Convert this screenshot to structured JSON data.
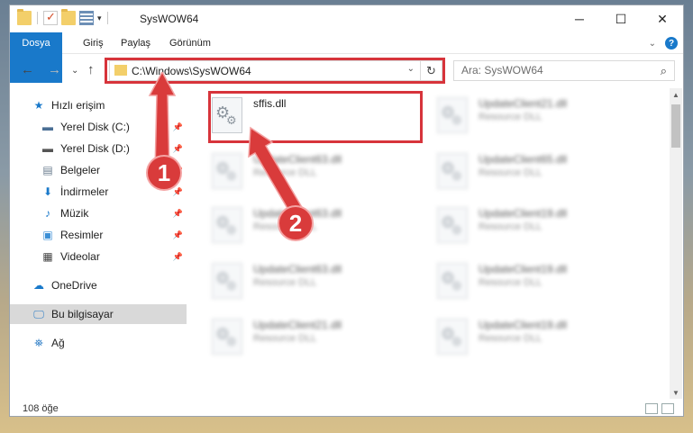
{
  "window": {
    "title": "SysWOW64",
    "controls": {
      "minimize": "─",
      "maximize": "☐",
      "close": "✕"
    },
    "qat_dropdown": "▾"
  },
  "ribbon": {
    "tabs": [
      "Dosya",
      "Giriş",
      "Paylaş",
      "Görünüm"
    ],
    "expand": "⌄",
    "help": "?"
  },
  "nav": {
    "back": "←",
    "forward": "→",
    "recent": "⌄",
    "up": "↑"
  },
  "address": {
    "path": "C:\\Windows\\SysWOW64",
    "dropdown": "⌄",
    "refresh": "↻"
  },
  "search": {
    "placeholder": "Ara: SysWOW64",
    "icon": "⌕"
  },
  "sidebar": {
    "items": [
      {
        "label": "Hızlı erişim",
        "icon": "star-icon",
        "glyph": "★",
        "color": "#1979ca",
        "pinned": false
      },
      {
        "label": "Yerel Disk (C:)",
        "icon": "drive-icon",
        "glyph": "▬",
        "color": "#4a6e94",
        "pinned": true
      },
      {
        "label": "Yerel Disk (D:)",
        "icon": "drive-icon",
        "glyph": "▬",
        "color": "#555",
        "pinned": true
      },
      {
        "label": "Belgeler",
        "icon": "documents-icon",
        "glyph": "▤",
        "color": "#6b7d8f",
        "pinned": true
      },
      {
        "label": "İndirmeler",
        "icon": "download-icon",
        "glyph": "⬇",
        "color": "#1979ca",
        "pinned": true
      },
      {
        "label": "Müzik",
        "icon": "music-icon",
        "glyph": "♪",
        "color": "#1979ca",
        "pinned": true
      },
      {
        "label": "Resimler",
        "icon": "pictures-icon",
        "glyph": "▣",
        "color": "#3b8fd6",
        "pinned": true
      },
      {
        "label": "Videolar",
        "icon": "video-icon",
        "glyph": "▦",
        "color": "#444",
        "pinned": true
      },
      {
        "label": "OneDrive",
        "icon": "cloud-icon",
        "glyph": "☁",
        "color": "#1979ca",
        "pinned": false
      },
      {
        "label": "Bu bilgisayar",
        "icon": "computer-icon",
        "glyph": "🖵",
        "color": "#2d7dc6",
        "pinned": false
      },
      {
        "label": "Ağ",
        "icon": "network-icon",
        "glyph": "⛯",
        "color": "#2d7dc6",
        "pinned": false
      }
    ],
    "pin_glyph": "📌"
  },
  "files": [
    {
      "name": "sffis.dll",
      "type": "",
      "selected": true
    },
    {
      "name": "UpdateClient21.dll",
      "type": "Resource DLL"
    },
    {
      "name": "UpdateClient63.dll",
      "type": "Resource DLL"
    },
    {
      "name": "UpdateClient65.dll",
      "type": "Resource DLL"
    },
    {
      "name": "UpdateClient63.dll",
      "type": "Resource DLL"
    },
    {
      "name": "UpdateClient19.dll",
      "type": "Resource DLL"
    },
    {
      "name": "UpdateClient63.dll",
      "type": "Resource DLL"
    },
    {
      "name": "UpdateClient19.dll",
      "type": "Resource DLL"
    },
    {
      "name": "UpdateClient21.dll",
      "type": "Resource DLL"
    },
    {
      "name": "UpdateClient19.dll",
      "type": "Resource DLL"
    }
  ],
  "status": {
    "item_count": "108 öğe"
  },
  "annotations": [
    {
      "number": "1"
    },
    {
      "number": "2"
    }
  ],
  "colors": {
    "accent": "#1979ca",
    "highlight": "#d7343b"
  }
}
